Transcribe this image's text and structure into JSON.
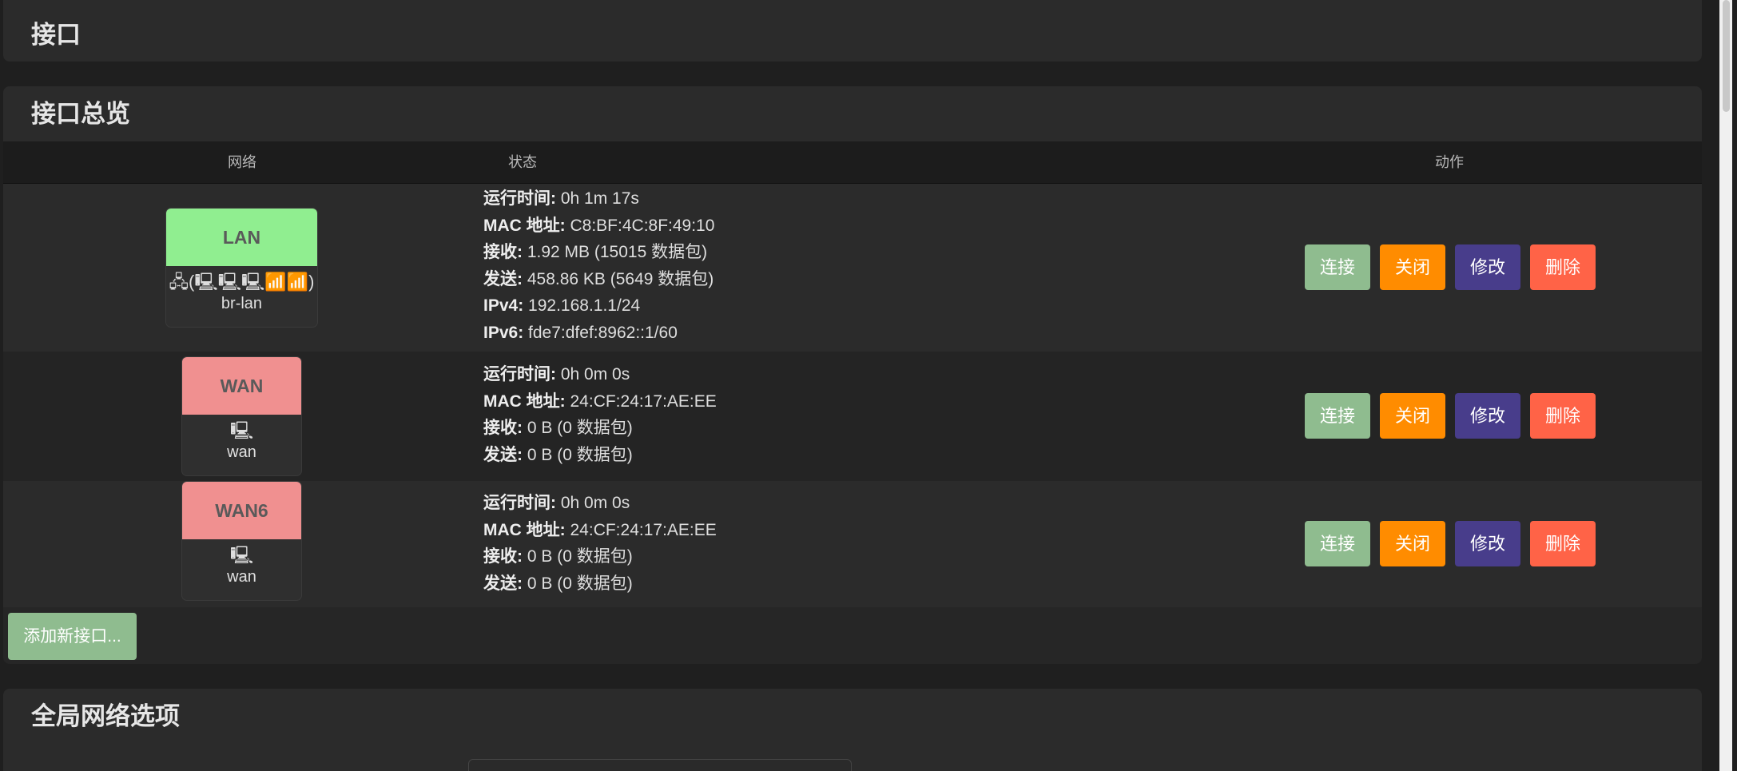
{
  "sections": {
    "interfaces_title": "接口",
    "overview_title": "接口总览",
    "global_title": "全局网络选项"
  },
  "table_headers": {
    "network": "网络",
    "status": "状态",
    "actions": "动作"
  },
  "buttons": {
    "connect": "连接",
    "stop": "关闭",
    "edit": "修改",
    "delete": "删除",
    "add": "添加新接口..."
  },
  "labels": {
    "uptime": "运行时间:",
    "mac": "MAC 地址:",
    "rx": "接收:",
    "tx": "发送:",
    "ipv4": "IPv4:",
    "ipv6": "IPv6:"
  },
  "interfaces": [
    {
      "name": "LAN",
      "color": "#90ee90",
      "icons": "🖧(🖳🖳🖳📶📶)",
      "device": "br-lan",
      "uptime": "0h 1m 17s",
      "mac": "C8:BF:4C:8F:49:10",
      "rx": "1.92 MB (15015 数据包)",
      "tx": "458.86 KB (5649 数据包)",
      "ipv4": "192.168.1.1/24",
      "ipv6": "fde7:dfef:8962::1/60"
    },
    {
      "name": "WAN",
      "color": "#f09090",
      "icons": "🖳",
      "device": "wan",
      "uptime": "0h 0m 0s",
      "mac": "24:CF:24:17:AE:EE",
      "rx": "0 B (0 数据包)",
      "tx": "0 B (0 数据包)"
    },
    {
      "name": "WAN6",
      "color": "#f09090",
      "icons": "🖳",
      "device": "wan",
      "uptime": "0h 0m 0s",
      "mac": "24:CF:24:17:AE:EE",
      "rx": "0 B (0 数据包)",
      "tx": "0 B (0 数据包)"
    }
  ]
}
